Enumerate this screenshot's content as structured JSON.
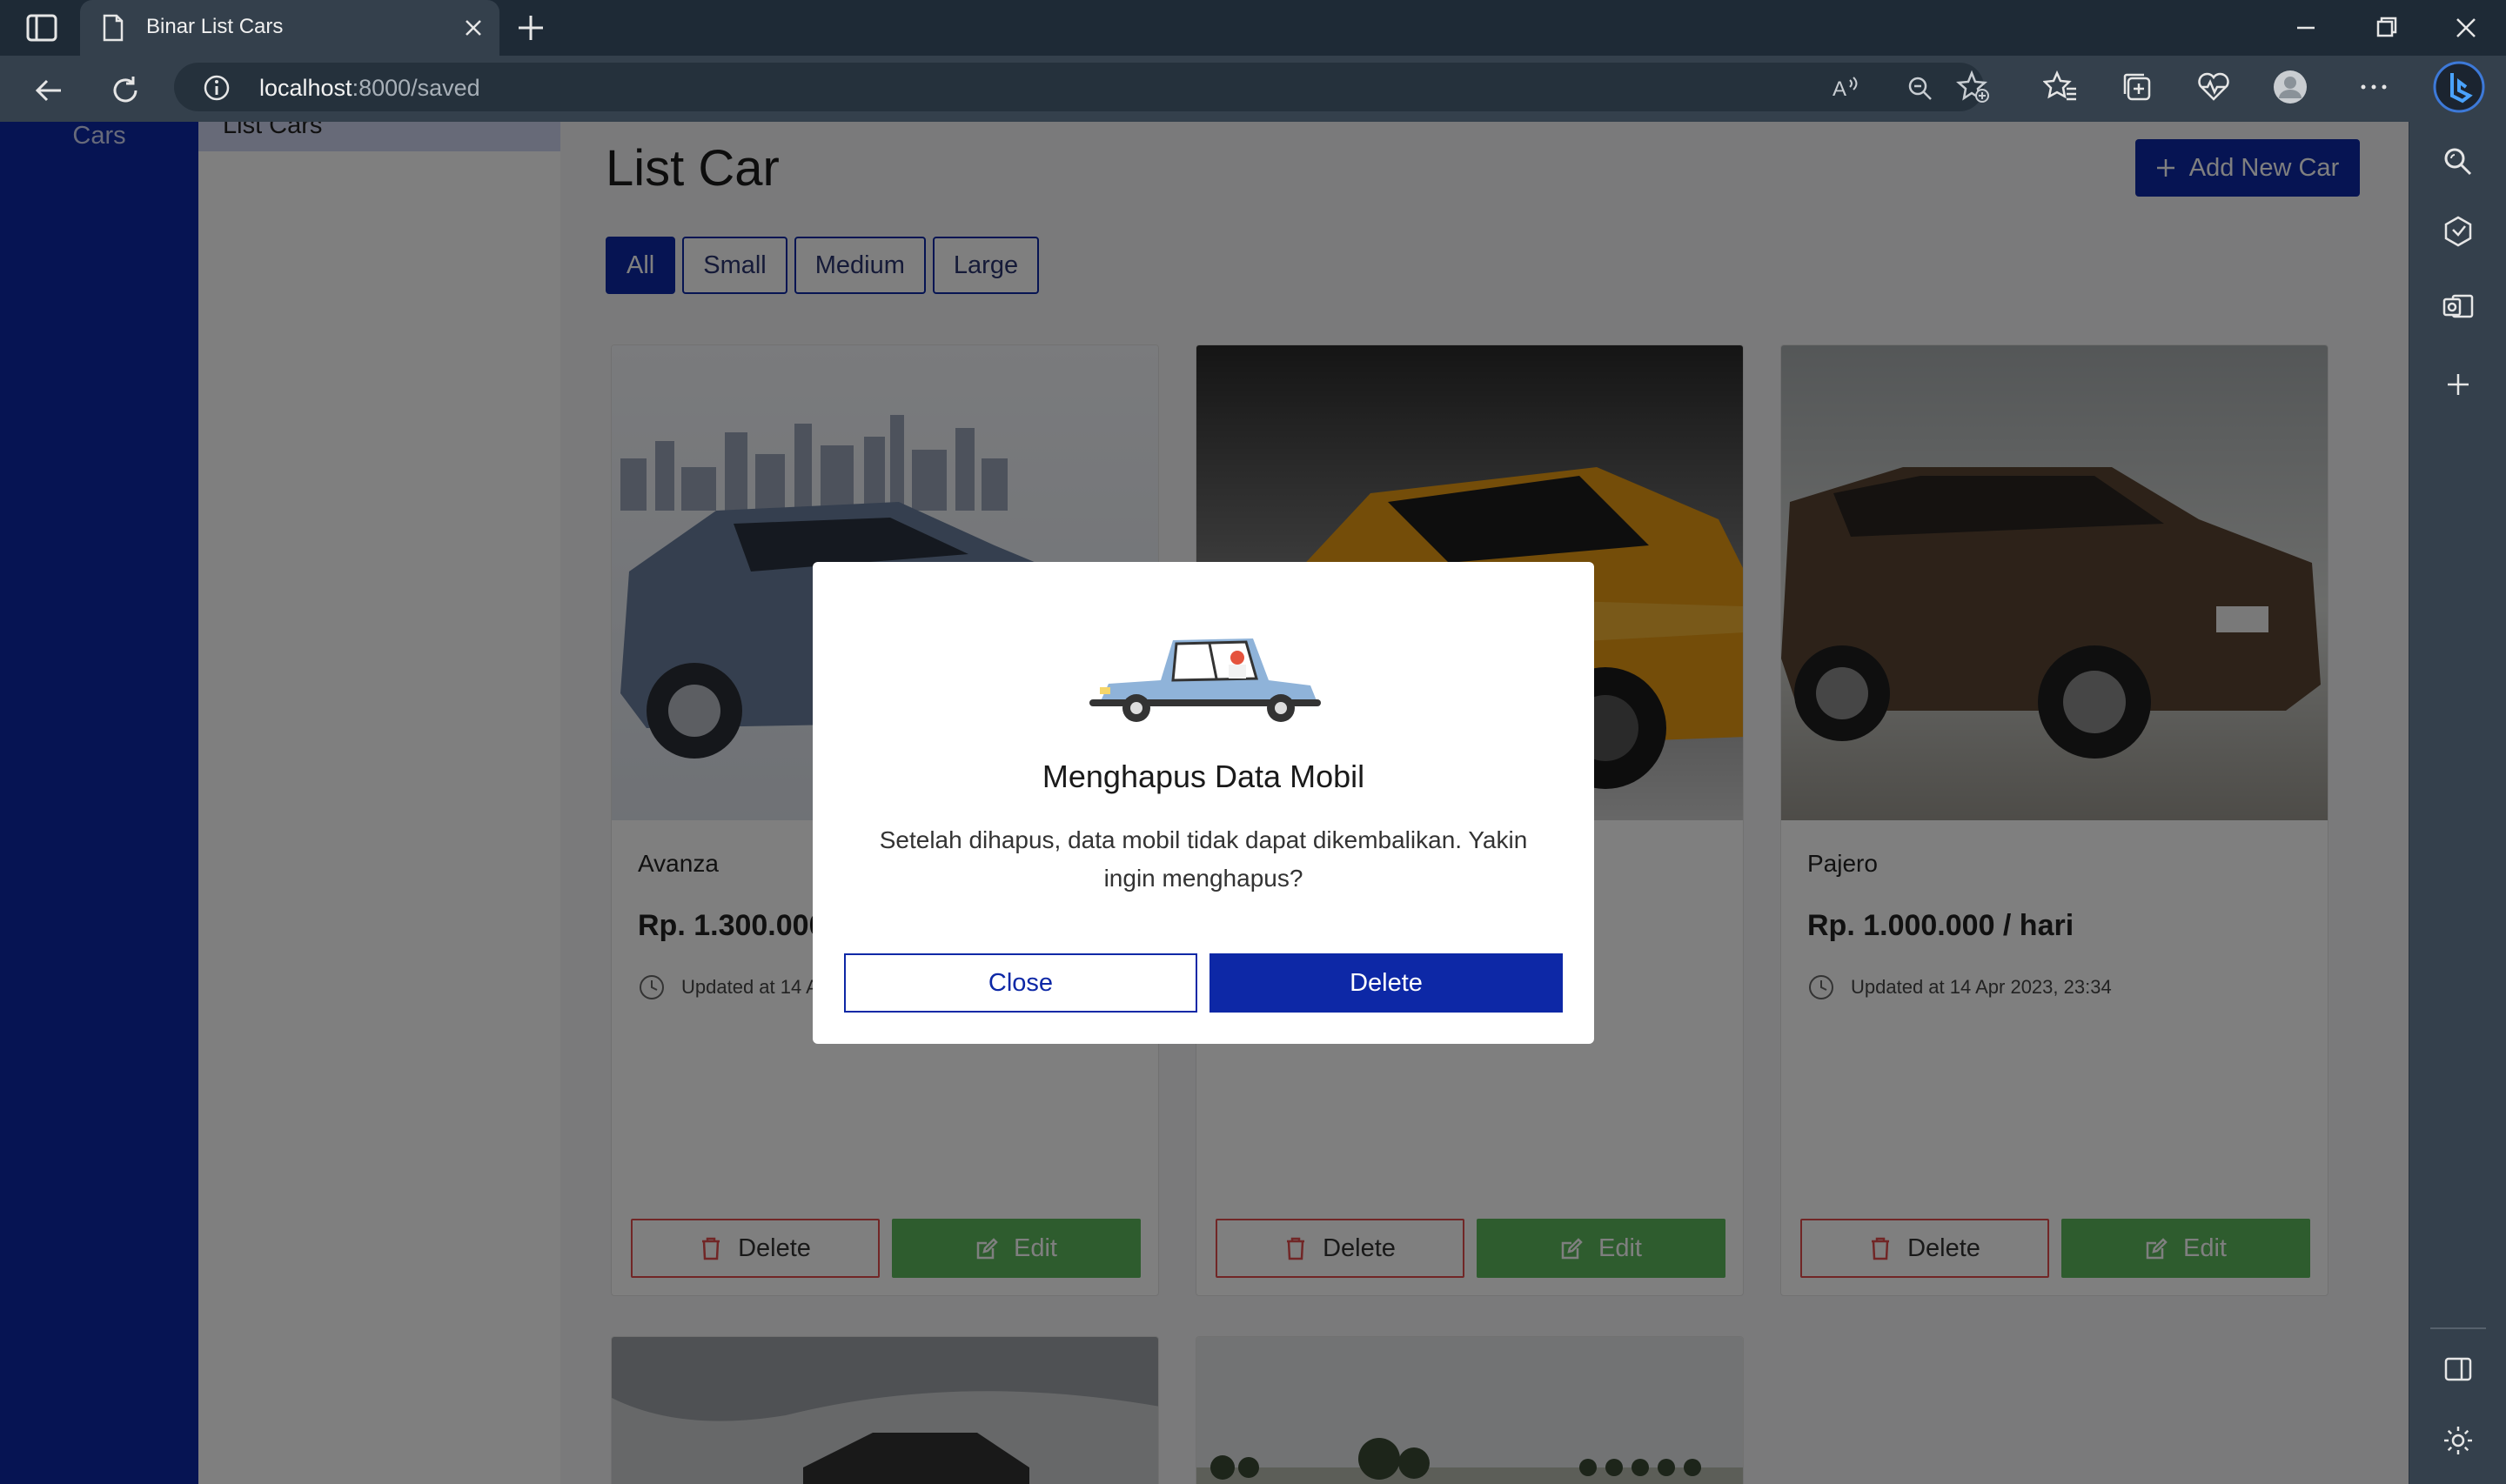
{
  "browser": {
    "tab_title": "Binar List Cars",
    "url_host": "localhost",
    "url_rest": ":8000/saved"
  },
  "sidebar": {
    "cars_label": "Cars",
    "active_item": "List Cars"
  },
  "main": {
    "title": "List Car",
    "add_button": "Add New Car",
    "filters": [
      "All",
      "Small",
      "Medium",
      "Large"
    ],
    "active_filter": "All"
  },
  "cars": [
    {
      "name": "Avanza",
      "price": "Rp. 1.300.000 / hari",
      "updated": "Updated at 14 Apr 2023, 23:34",
      "delete_label": "Delete",
      "edit_label": "Edit"
    },
    {
      "name": "",
      "price": "",
      "updated": "",
      "delete_label": "Delete",
      "edit_label": "Edit"
    },
    {
      "name": "Pajero",
      "price": "Rp. 1.000.000 / hari",
      "updated": "Updated at 14 Apr 2023, 23:34",
      "delete_label": "Delete",
      "edit_label": "Edit"
    }
  ],
  "modal": {
    "title": "Menghapus Data Mobil",
    "body": "Setelah dihapus, data mobil tidak dapat dikembalikan. Yakin ingin menghapus?",
    "close_label": "Close",
    "delete_label": "Delete"
  },
  "colors": {
    "primary": "#0d28a6",
    "success": "#5cb85c",
    "danger": "#e24d4d"
  }
}
